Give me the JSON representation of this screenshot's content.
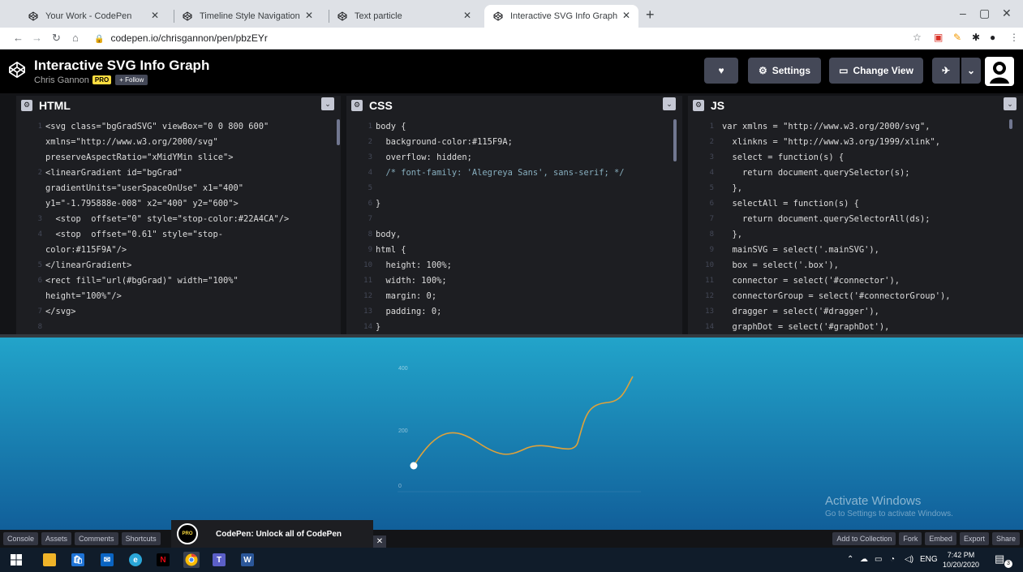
{
  "browser": {
    "tabs": [
      {
        "title": "Your Work - CodePen"
      },
      {
        "title": "Timeline Style Navigation"
      },
      {
        "title": "Text particle"
      },
      {
        "title": "Interactive SVG Info Graph"
      }
    ],
    "url": "codepen.io/chrisgannon/pen/pbzEYr"
  },
  "pen": {
    "title": "Interactive SVG Info Graph",
    "author": "Chris Gannon",
    "pro_label": "PRO",
    "follow_label": "+ Follow"
  },
  "header_buttons": {
    "settings": "Settings",
    "change_view": "Change View"
  },
  "editors": {
    "html": {
      "name": "HTML",
      "lines": [
        {
          "n": "1",
          "text": "<svg class=\"bgGradSVG\" viewBox=\"0 0 800 600\""
        },
        {
          "n": "",
          "text": "xmlns=\"http://www.w3.org/2000/svg\""
        },
        {
          "n": "",
          "text": "preserveAspectRatio=\"xMidYMin slice\">"
        },
        {
          "n": "2",
          "text": "<linearGradient id=\"bgGrad\""
        },
        {
          "n": "",
          "text": "gradientUnits=\"userSpaceOnUse\" x1=\"400\""
        },
        {
          "n": "",
          "text": "y1=\"-1.795888e-008\" x2=\"400\" y2=\"600\">"
        },
        {
          "n": "3",
          "text": "  <stop  offset=\"0\" style=\"stop-color:#22A4CA\"/>"
        },
        {
          "n": "4",
          "text": "  <stop  offset=\"0.61\" style=\"stop-"
        },
        {
          "n": "",
          "text": "color:#115F9A\"/>"
        },
        {
          "n": "5",
          "text": "</linearGradient>"
        },
        {
          "n": "6",
          "text": "<rect fill=\"url(#bgGrad)\" width=\"100%\""
        },
        {
          "n": "",
          "text": "height=\"100%\"/>"
        },
        {
          "n": "7",
          "text": "</svg>"
        },
        {
          "n": "8",
          "text": ""
        }
      ]
    },
    "css": {
      "name": "CSS",
      "lines": [
        {
          "n": "1",
          "text": "body {"
        },
        {
          "n": "2",
          "text": "  background-color:#115F9A;"
        },
        {
          "n": "3",
          "text": "  overflow: hidden;"
        },
        {
          "n": "4",
          "text": "  /* font-family: 'Alegreya Sans', sans-serif; */"
        },
        {
          "n": "5",
          "text": ""
        },
        {
          "n": "6",
          "text": "}"
        },
        {
          "n": "7",
          "text": ""
        },
        {
          "n": "8",
          "text": "body,"
        },
        {
          "n": "9",
          "text": "html {"
        },
        {
          "n": "10",
          "text": "  height: 100%;"
        },
        {
          "n": "11",
          "text": "  width: 100%;"
        },
        {
          "n": "12",
          "text": "  margin: 0;"
        },
        {
          "n": "13",
          "text": "  padding: 0;"
        },
        {
          "n": "14",
          "text": "}"
        }
      ]
    },
    "js": {
      "name": "JS",
      "lines": [
        {
          "n": "1",
          "text": "var xmlns = \"http://www.w3.org/2000/svg\","
        },
        {
          "n": "2",
          "text": "  xlinkns = \"http://www.w3.org/1999/xlink\","
        },
        {
          "n": "3",
          "text": "  select = function(s) {"
        },
        {
          "n": "4",
          "text": "    return document.querySelector(s);"
        },
        {
          "n": "5",
          "text": "  },"
        },
        {
          "n": "6",
          "text": "  selectAll = function(s) {"
        },
        {
          "n": "7",
          "text": "    return document.querySelectorAll(ds);"
        },
        {
          "n": "8",
          "text": "  },"
        },
        {
          "n": "9",
          "text": "  mainSVG = select('.mainSVG'),"
        },
        {
          "n": "10",
          "text": "  box = select('.box'),"
        },
        {
          "n": "11",
          "text": "  connector = select('#connector'),"
        },
        {
          "n": "12",
          "text": "  connectorGroup = select('#connectorGroup'),"
        },
        {
          "n": "13",
          "text": "  dragger = select('#dragger'),"
        },
        {
          "n": "14",
          "text": "  graphDot = select('#graphDot'),"
        }
      ]
    }
  },
  "preview": {
    "y_ticks": [
      "400",
      "200",
      "0"
    ],
    "curve_color": "#e0a23a",
    "bg_top": "#22A4CA",
    "bg_bottom": "#115F9A",
    "activate_title": "Activate Windows",
    "activate_sub": "Go to Settings to activate Windows."
  },
  "footer": {
    "left_buttons": [
      "Console",
      "Assets",
      "Comments",
      "Shortcuts"
    ],
    "right_buttons": [
      "Add to Collection",
      "Fork",
      "Embed",
      "Export",
      "Share"
    ],
    "promo_badge": "PRO",
    "promo_text": "CodePen: Unlock all of CodePen"
  },
  "taskbar": {
    "lang": "ENG",
    "time": "7:42 PM",
    "date": "10/20/2020",
    "notif_count": "3"
  }
}
